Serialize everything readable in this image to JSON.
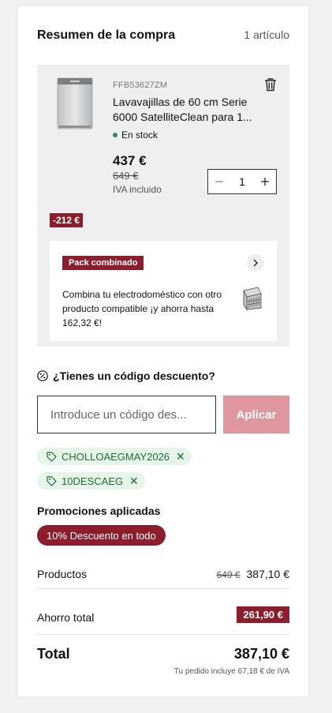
{
  "header": {
    "title": "Resumen de la compra",
    "count": "1 artículo"
  },
  "item": {
    "sku": "FFB53627ZM",
    "name": "Lavavajillas de 60 cm Serie 6000 SatelliteClean para 1...",
    "stock": "En stock",
    "price": "437 €",
    "old_price": "649 €",
    "vat": "IVA incluido",
    "quantity": "1",
    "discount": "-212 €",
    "icons": {
      "delete": "trash-icon",
      "minus": "minus-icon",
      "plus": "plus-icon"
    }
  },
  "pack": {
    "tag": "Pack combinado",
    "text": "Combina tu electrodoméstico con otro producto compatible ¡y ahorra hasta 162,32 €!",
    "icons": {
      "arrow": "chevron-right-icon",
      "image": "dishwasher-basket-image"
    }
  },
  "coupon": {
    "title": "¿Tienes un código descuento?",
    "placeholder": "Introduce un código des...",
    "apply_label": "Aplicar",
    "codes": [
      "CHOLLOAEGMAY2026",
      "10DESCAEG"
    ]
  },
  "promotions": {
    "title": "Promociones aplicadas",
    "applied": "10% Descuento en todo"
  },
  "summary": {
    "products_label": "Productos",
    "products_old": "649 €",
    "products_value": "387,10 €",
    "savings_label": "Ahorro total",
    "savings_value": "261,90 €",
    "total_label": "Total",
    "total_value": "387,10 €",
    "vat_note": "Tu pedido incluye 67,18 € de IVA"
  },
  "colors": {
    "brand": "#8c1d2c",
    "apply_disabled": "#e0969d",
    "chip_bg": "#e6f4ea",
    "chip_text": "#1e6b35",
    "stock_dot": "#2e8b57"
  }
}
